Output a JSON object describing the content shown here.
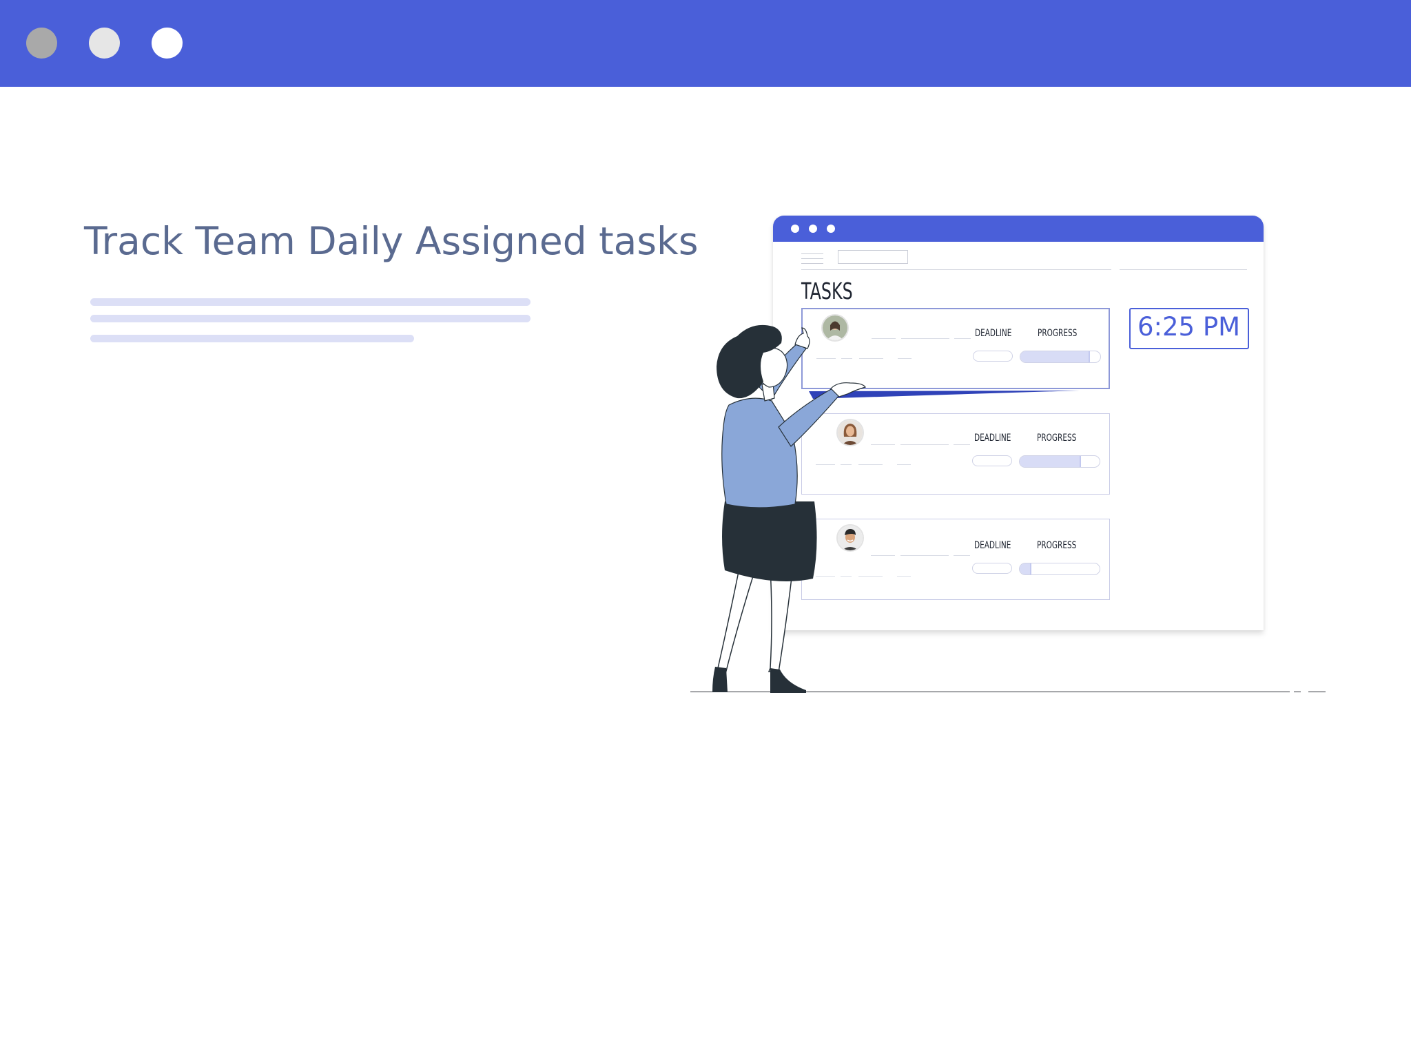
{
  "window_chrome": {
    "bar_color": "#4a5fd9",
    "controls": [
      "close-dot",
      "minimize-dot",
      "maximize-dot"
    ]
  },
  "hero": {
    "headline": "Track Team Daily Assigned tasks"
  },
  "illustration": {
    "app_window": {
      "title": "TASKS",
      "clock": "6:25 PM",
      "tasks": [
        {
          "deadline_label": "DEADLINE",
          "progress_label": "PROGRESS",
          "progress": 0.87
        },
        {
          "deadline_label": "DEADLINE",
          "progress_label": "PROGRESS",
          "progress": 0.77
        },
        {
          "deadline_label": "DEADLINE",
          "progress_label": "PROGRESS",
          "progress": 0.15
        }
      ]
    },
    "colors": {
      "accent": "#4a5fd9",
      "blouse": "#8aa7d8",
      "skirt": "#263038"
    }
  }
}
